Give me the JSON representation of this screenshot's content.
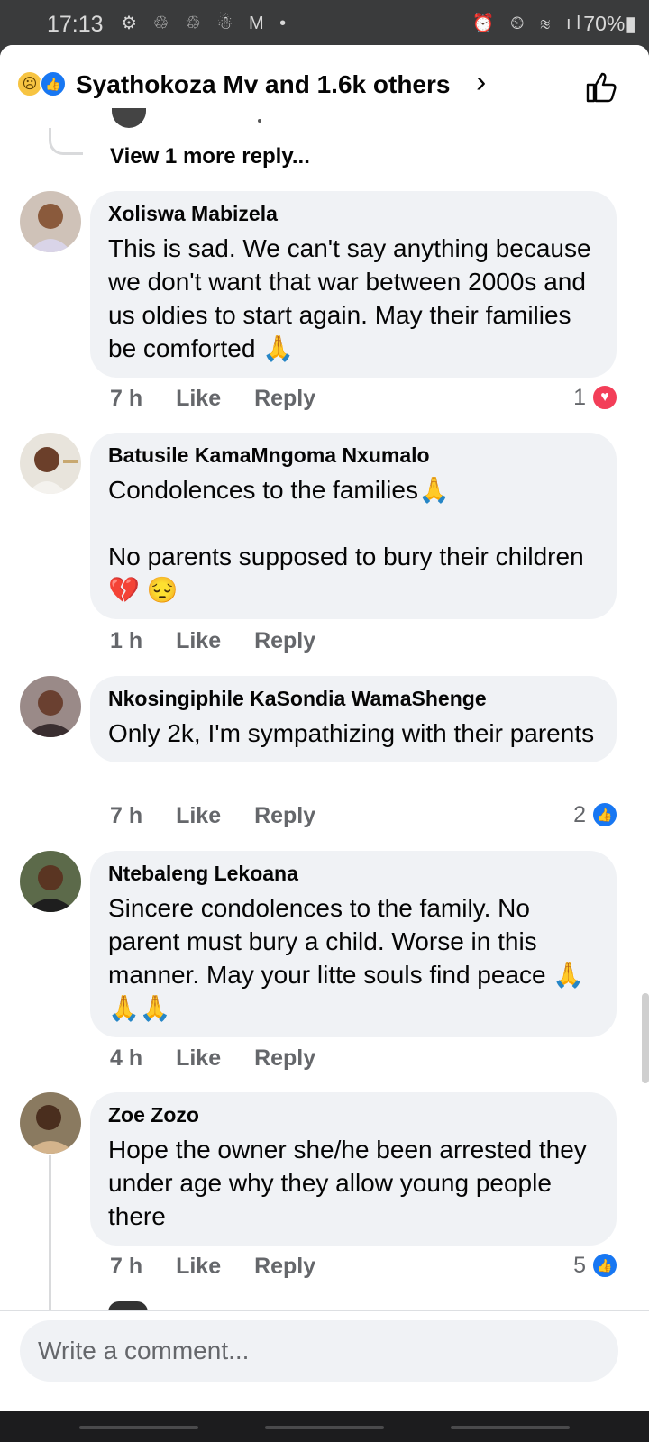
{
  "status_bar": {
    "time": "17:13",
    "left_icons": "⚙ ♲ ♲ ☃ M •",
    "right_icons": "⏰ ⏲ ≋ ıl",
    "battery": "70%▮"
  },
  "header": {
    "title": "Syathokoza Mv and 1.6k others",
    "reaction_icons": [
      "sad-emoji",
      "like-icon"
    ]
  },
  "thread": {
    "view_more": "View 1 more reply..."
  },
  "comments": [
    {
      "author": "Xoliswa Mabizela",
      "text": "This is sad. We can't say anything because we don't want that war between 2000s and us oldies to start again. May their families be comforted 🙏",
      "time": "7 h",
      "like_label": "Like",
      "reply_label": "Reply",
      "reaction_count": "1",
      "reaction_type": "heart"
    },
    {
      "author": "Batusile KamaMngoma Nxumalo",
      "text": "Condolences to the families🙏\n\nNo parents supposed to bury their children💔 😔",
      "time": "1 h",
      "like_label": "Like",
      "reply_label": "Reply"
    },
    {
      "author": "Nkosingiphile KaSondia WamaShenge",
      "text": "Only 2k, I'm sympathizing with their parents",
      "time": "7 h",
      "like_label": "Like",
      "reply_label": "Reply",
      "reaction_count": "2",
      "reaction_type": "like"
    },
    {
      "author": "Ntebaleng Lekoana",
      "text": "Sincere condolences to the family. No parent must bury a child. Worse in this manner. May your litte souls find peace 🙏🙏🙏",
      "time": "4 h",
      "like_label": "Like",
      "reply_label": "Reply"
    },
    {
      "author": "Zoe Zozo",
      "text": "Hope the owner she/he been arrested they under age why they allow young people there",
      "time": "7 h",
      "like_label": "Like",
      "reply_label": "Reply",
      "reaction_count": "5",
      "reaction_type": "like"
    }
  ],
  "composer": {
    "placeholder": "Write a comment..."
  }
}
